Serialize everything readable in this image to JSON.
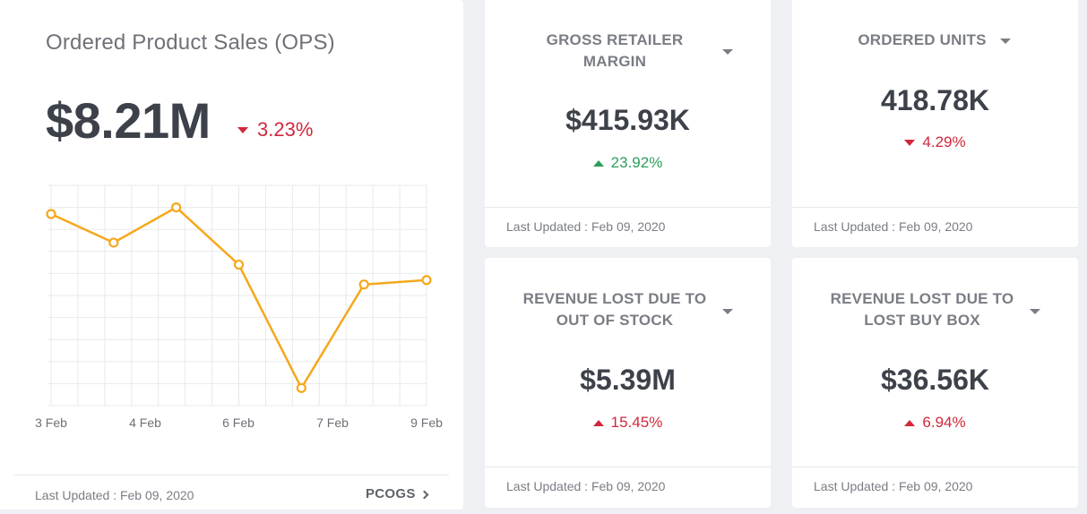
{
  "main": {
    "title": "Ordered Product Sales (OPS)",
    "value": "$8.21M",
    "change": "3.23%",
    "change_direction": "down",
    "updated": "Last Updated : Feb 09, 2020",
    "link_label": "PCOGS",
    "icons": [
      "caret-down-icon",
      "chevron-right-icon"
    ]
  },
  "chart_data": {
    "type": "line",
    "x": [
      "3 Feb",
      "3.7 Feb",
      "4.3 Feb",
      "5 Feb",
      "5.7 Feb",
      "6.3 Feb",
      "7 Feb"
    ],
    "tick_labels": [
      "3 Feb",
      "4 Feb",
      "6 Feb",
      "7 Feb",
      "9 Feb"
    ],
    "values": [
      0.77,
      0.64,
      0.8,
      0.54,
      -0.02,
      0.45,
      0.47
    ],
    "ylim": [
      -0.1,
      0.9
    ],
    "grid": true,
    "line_color": "#f5a81c",
    "marker_fill": "#ffffff"
  },
  "cards": {
    "gross_retailer_margin": {
      "title_line1": "GROSS RETAILER",
      "title_line2": "MARGIN",
      "value": "$415.93K",
      "change": "23.92%",
      "change_direction": "up",
      "change_color": "#2e9e5b",
      "updated": "Last Updated : Feb 09, 2020"
    },
    "ordered_units": {
      "title_line1": "ORDERED UNITS",
      "value": "418.78K",
      "change": "4.29%",
      "change_direction": "down",
      "change_color": "#d0283c",
      "updated": "Last Updated : Feb 09, 2020"
    },
    "revenue_lost_oos": {
      "title_line1": "REVENUE LOST DUE TO",
      "title_line2": "OUT OF STOCK",
      "value": "$5.39M",
      "change": "15.45%",
      "change_direction": "up",
      "change_color": "#d0283c",
      "updated": "Last Updated : Feb 09, 2020"
    },
    "revenue_lost_buybox": {
      "title_line1": "REVENUE LOST DUE TO",
      "title_line2": "LOST BUY BOX",
      "value": "$36.56K",
      "change": "6.94%",
      "change_direction": "up",
      "change_color": "#d0283c",
      "updated": "Last Updated : Feb 09, 2020"
    }
  }
}
